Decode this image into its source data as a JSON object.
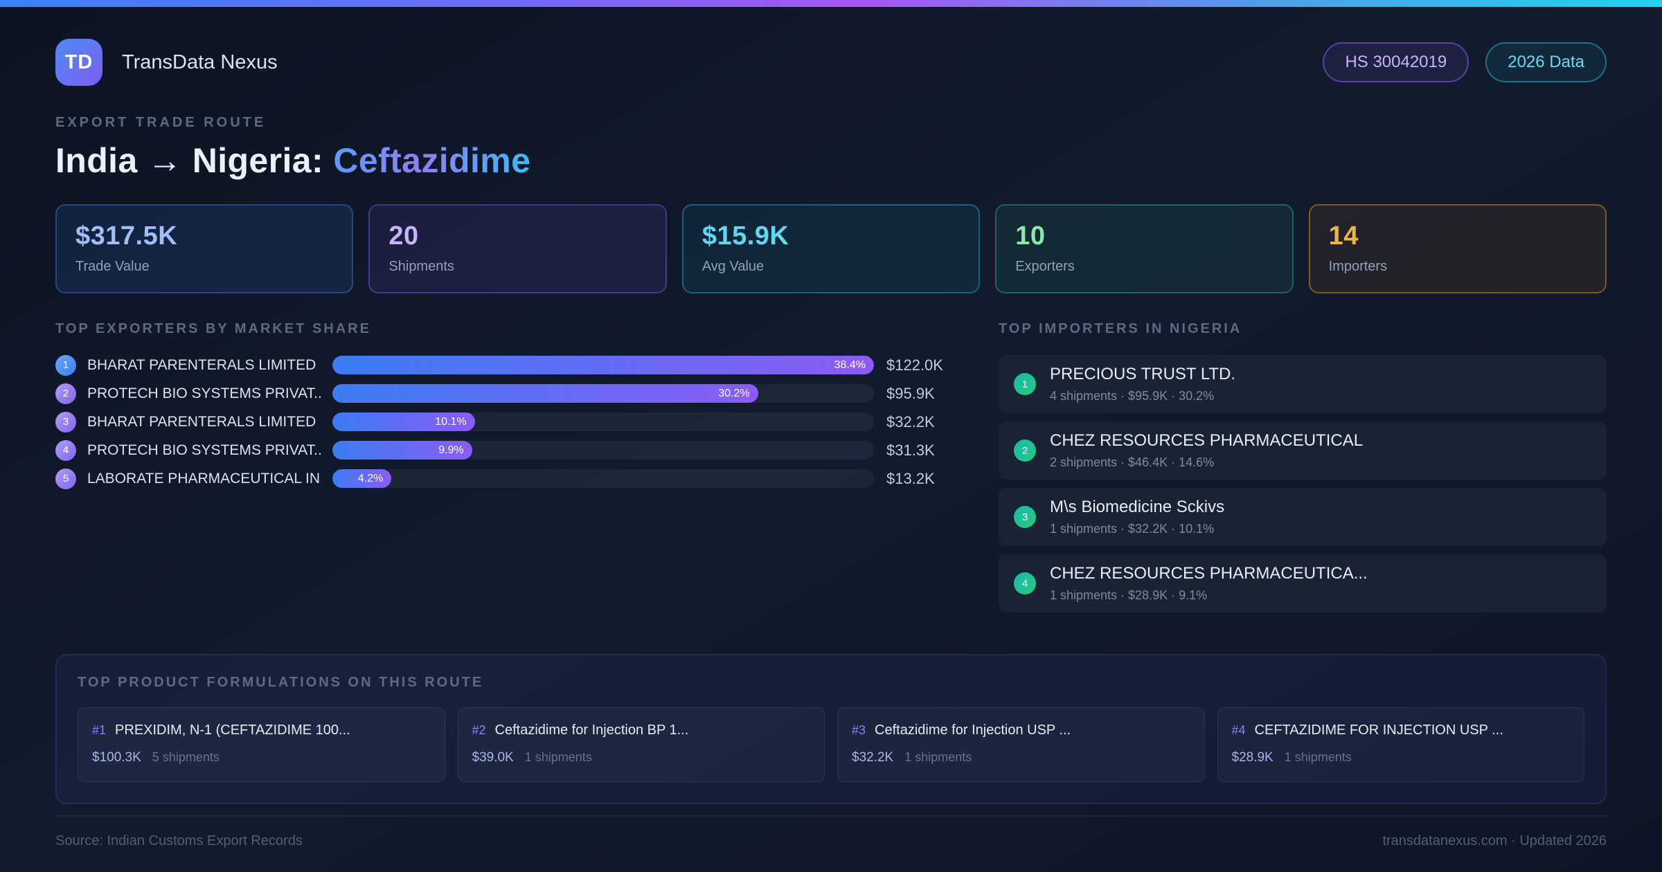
{
  "header": {
    "logo_initials": "TD",
    "app_name": "TransData Nexus",
    "badges": [
      {
        "label": "HS 30042019",
        "variant": "purple"
      },
      {
        "label": "2026 Data",
        "variant": "cyan"
      }
    ]
  },
  "title": {
    "eyebrow": "EXPORT TRADE ROUTE",
    "origin": "India",
    "arrow": "→",
    "destination": "Nigeria:",
    "product": "Ceftazidime"
  },
  "stats": [
    {
      "value": "$317.5K",
      "label": "Trade Value",
      "variant": "blue"
    },
    {
      "value": "20",
      "label": "Shipments",
      "variant": "purple"
    },
    {
      "value": "$15.9K",
      "label": "Avg Value",
      "variant": "cyan"
    },
    {
      "value": "10",
      "label": "Exporters",
      "variant": "green"
    },
    {
      "value": "14",
      "label": "Importers",
      "variant": "amber"
    }
  ],
  "exporters": {
    "heading": "TOP EXPORTERS BY MARKET SHARE",
    "max_share_pct": 38.4,
    "items": [
      {
        "rank": "1",
        "name": "BHARAT PARENTERALS LIMITED",
        "share_pct": 38.4,
        "share_label": "38.4%",
        "value": "$122.0K"
      },
      {
        "rank": "2",
        "name": "PROTECH BIO SYSTEMS PRIVAT...",
        "share_pct": 30.2,
        "share_label": "30.2%",
        "value": "$95.9K"
      },
      {
        "rank": "3",
        "name": "BHARAT PARENTERALS LIMITED",
        "share_pct": 10.1,
        "share_label": "10.1%",
        "value": "$32.2K"
      },
      {
        "rank": "4",
        "name": "PROTECH BIO SYSTEMS PRIVAT...",
        "share_pct": 9.9,
        "share_label": "9.9%",
        "value": "$31.3K"
      },
      {
        "rank": "5",
        "name": "LABORATE PHARMACEUTICAL IN...",
        "share_pct": 4.2,
        "share_label": "4.2%",
        "value": "$13.2K"
      }
    ]
  },
  "importers": {
    "heading": "TOP IMPORTERS IN NIGERIA",
    "items": [
      {
        "rank": "1",
        "name": "PRECIOUS TRUST LTD.",
        "meta": "4 shipments · $95.9K · 30.2%"
      },
      {
        "rank": "2",
        "name": "CHEZ RESOURCES PHARMACEUTICAL",
        "meta": "2 shipments · $46.4K · 14.6%"
      },
      {
        "rank": "3",
        "name": "M\\s Biomedicine Sckivs",
        "meta": "1 shipments · $32.2K · 10.1%"
      },
      {
        "rank": "4",
        "name": "CHEZ RESOURCES PHARMACEUTICA...",
        "meta": "1 shipments · $28.9K · 9.1%"
      }
    ]
  },
  "formulations": {
    "heading": "TOP PRODUCT FORMULATIONS ON THIS ROUTE",
    "items": [
      {
        "rank": "#1",
        "name": "PREXIDIM, N-1 (CEFTAZIDIME 100...",
        "value": "$100.3K",
        "shipments": "5 shipments"
      },
      {
        "rank": "#2",
        "name": "Ceftazidime for Injection BP 1...",
        "value": "$39.0K",
        "shipments": "1 shipments"
      },
      {
        "rank": "#3",
        "name": "Ceftazidime for Injection USP ...",
        "value": "$32.2K",
        "shipments": "1 shipments"
      },
      {
        "rank": "#4",
        "name": "CEFTAZIDIME FOR INJECTION USP ...",
        "value": "$28.9K",
        "shipments": "1 shipments"
      }
    ]
  },
  "footer": {
    "source": "Source: Indian Customs Export Records",
    "site": "transdatanexus.com · Updated 2026"
  },
  "colors": {
    "accent_blue": "#3b82f6",
    "accent_purple": "#8b5cf6",
    "accent_violet": "#a855f7",
    "accent_cyan": "#22d3ee",
    "accent_green": "#34d399",
    "accent_amber": "#f59e0b",
    "importer_badge_from": "#16bca8",
    "importer_badge_to": "#2bc77f",
    "background": "#0f1726"
  }
}
